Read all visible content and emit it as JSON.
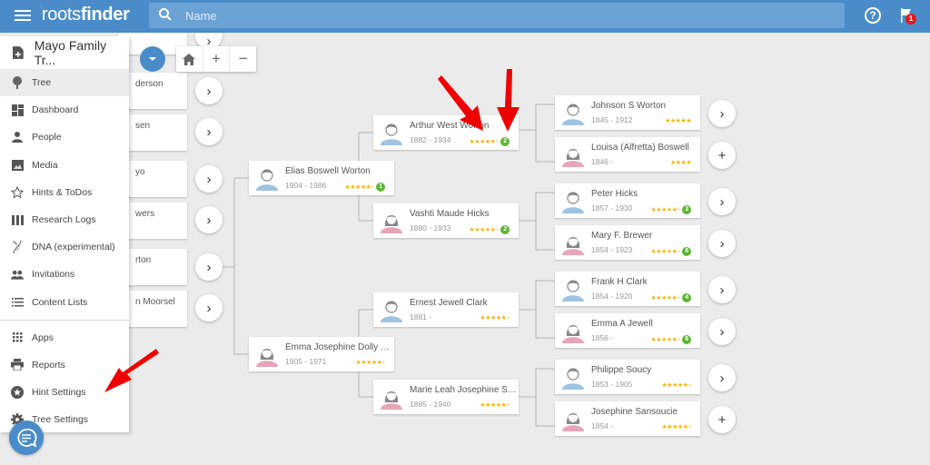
{
  "app": {
    "logo_part1": "roots",
    "logo_part2": "finder",
    "search_placeholder": "Name",
    "help_icon": "?",
    "notification_count": "1"
  },
  "sidebar": {
    "tree_name": "Mayo Family Tr...",
    "items": [
      {
        "label": "Tree",
        "icon": "tree-icon",
        "active": true
      },
      {
        "label": "Dashboard",
        "icon": "dashboard-icon"
      },
      {
        "label": "People",
        "icon": "person-icon"
      },
      {
        "label": "Media",
        "icon": "image-icon"
      },
      {
        "label": "Hints & ToDos",
        "icon": "star-outline-icon"
      },
      {
        "label": "Research Logs",
        "icon": "columns-icon"
      },
      {
        "label": "DNA (experimental)",
        "icon": "dna-icon"
      },
      {
        "label": "Invitations",
        "icon": "people-icon"
      },
      {
        "label": "Content Lists",
        "icon": "list-icon"
      }
    ],
    "items2": [
      {
        "label": "Apps",
        "icon": "apps-grid-icon"
      },
      {
        "label": "Reports",
        "icon": "printer-icon"
      },
      {
        "label": "Hint Settings",
        "icon": "star-circle-icon"
      },
      {
        "label": "Tree Settings",
        "icon": "gear-icon"
      }
    ]
  },
  "zoom_controls": {
    "home": "⌂",
    "plus": "+",
    "minus": "−"
  },
  "left_cards": [
    {
      "label": "derson"
    },
    {
      "label": "sen"
    },
    {
      "label": "yo"
    },
    {
      "label": "wers"
    },
    {
      "label": "rton"
    },
    {
      "label": "n Moorsel"
    }
  ],
  "people": [
    {
      "name": "Elias Boswell Worton",
      "years": "1904 - 1986",
      "gender": "male",
      "stars": "★★★★★",
      "plus": true,
      "hints": "1"
    },
    {
      "name": "Emma Josephine Dolly Cl...",
      "years": "1905 - 1971",
      "gender": "female",
      "stars": "★★★★★",
      "plus": true,
      "hints": ""
    },
    {
      "name": "Arthur West Worton",
      "years": "1882 - 1934",
      "gender": "male",
      "stars": "★★★★★",
      "plus": true,
      "hints": "2"
    },
    {
      "name": "Vashti Maude Hicks",
      "years": "1880 - 1933",
      "gender": "female",
      "stars": "★★★★★",
      "plus": true,
      "hints": "2"
    },
    {
      "name": "Ernest Jewell Clark",
      "years": "1881 -",
      "gender": "male",
      "stars": "★★★★★",
      "plus": true,
      "hints": ""
    },
    {
      "name": "Marie Leah Josephine So...",
      "years": "1885 - 1940",
      "gender": "female",
      "stars": "★★★★★",
      "plus": true,
      "hints": ""
    },
    {
      "name": "Johnson S Worton",
      "years": "1845 - 1912",
      "gender": "male",
      "stars": "★★★★★",
      "plus": false,
      "hints": ""
    },
    {
      "name": "Louisa (Alfretta) Boswell",
      "years": "1846 -",
      "gender": "female",
      "stars": "★★★★",
      "plus": false,
      "hints": ""
    },
    {
      "name": "Peter Hicks",
      "years": "1857 - 1930",
      "gender": "male",
      "stars": "★★★★★",
      "plus": true,
      "hints": "3"
    },
    {
      "name": "Mary F. Brewer",
      "years": "1854 - 1923",
      "gender": "female",
      "stars": "★★★★★",
      "plus": true,
      "hints": "6"
    },
    {
      "name": "Frank H Clark",
      "years": "1854 - 1920",
      "gender": "male",
      "stars": "★★★★★",
      "plus": true,
      "hints": "4"
    },
    {
      "name": "Emma A Jewell",
      "years": "1856 -",
      "gender": "female",
      "stars": "★★★★★",
      "plus": true,
      "hints": "6"
    },
    {
      "name": "Philippe Soucy",
      "years": "1853 - 1905",
      "gender": "male",
      "stars": "★★★★★",
      "plus": true,
      "hints": ""
    },
    {
      "name": "Josephine Sansoucie",
      "years": "1854 -",
      "gender": "female",
      "stars": "★★★★★",
      "plus": true,
      "hints": ""
    }
  ],
  "expand_buttons": [
    "›",
    "+",
    "›",
    "›",
    "›",
    "›",
    "›",
    "+"
  ],
  "colors": {
    "brand": "#4a8cc9",
    "star": "#f7b500",
    "hint_badge": "#5cb531",
    "male": "#9fc3e0",
    "female": "#e7a6b8",
    "annotation_arrow": "#ee0000"
  }
}
